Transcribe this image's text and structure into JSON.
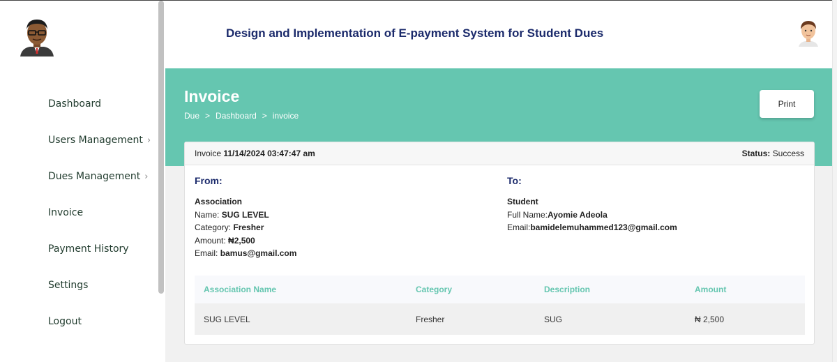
{
  "app": {
    "title": "Design and Implementation of E-payment System for Student Dues"
  },
  "sidebar": {
    "items": [
      {
        "label": "Dashboard",
        "chevron": false
      },
      {
        "label": "Users Management",
        "chevron": true
      },
      {
        "label": "Dues Management",
        "chevron": true
      },
      {
        "label": "Invoice",
        "chevron": false
      },
      {
        "label": "Payment History",
        "chevron": false
      },
      {
        "label": "Settings",
        "chevron": false
      },
      {
        "label": "Logout",
        "chevron": false
      }
    ],
    "chevron_glyph": "›"
  },
  "page": {
    "title": "Invoice",
    "breadcrumb": [
      "Due",
      "Dashboard",
      "invoice"
    ],
    "breadcrumb_sep": ">",
    "print_label": "Print"
  },
  "invoice": {
    "header_label": "Invoice",
    "datetime": "11/14/2024 03:47:47 am",
    "status_label": "Status:",
    "status_value": "Success",
    "from": {
      "heading": "From:",
      "entity": "Association",
      "name_label": "Name:",
      "name": "SUG LEVEL",
      "category_label": "Category:",
      "category": "Fresher",
      "amount_label": "Amount:",
      "amount": "₦2,500",
      "email_label": "Email:",
      "email": "bamus@gmail.com"
    },
    "to": {
      "heading": "To:",
      "entity": "Student",
      "fullname_label": "Full Name:",
      "fullname": "Ayomie Adeola",
      "email_label": "Email:",
      "email": "bamidelemuhammed123@gmail.com"
    },
    "table": {
      "headers": [
        "Association Name",
        "Category",
        "Description",
        "Amount"
      ],
      "rows": [
        [
          "SUG LEVEL",
          "Fresher",
          "SUG",
          "₦ 2,500"
        ]
      ]
    }
  },
  "colors": {
    "accent": "#65c6b0",
    "title": "#1b2a6b"
  }
}
